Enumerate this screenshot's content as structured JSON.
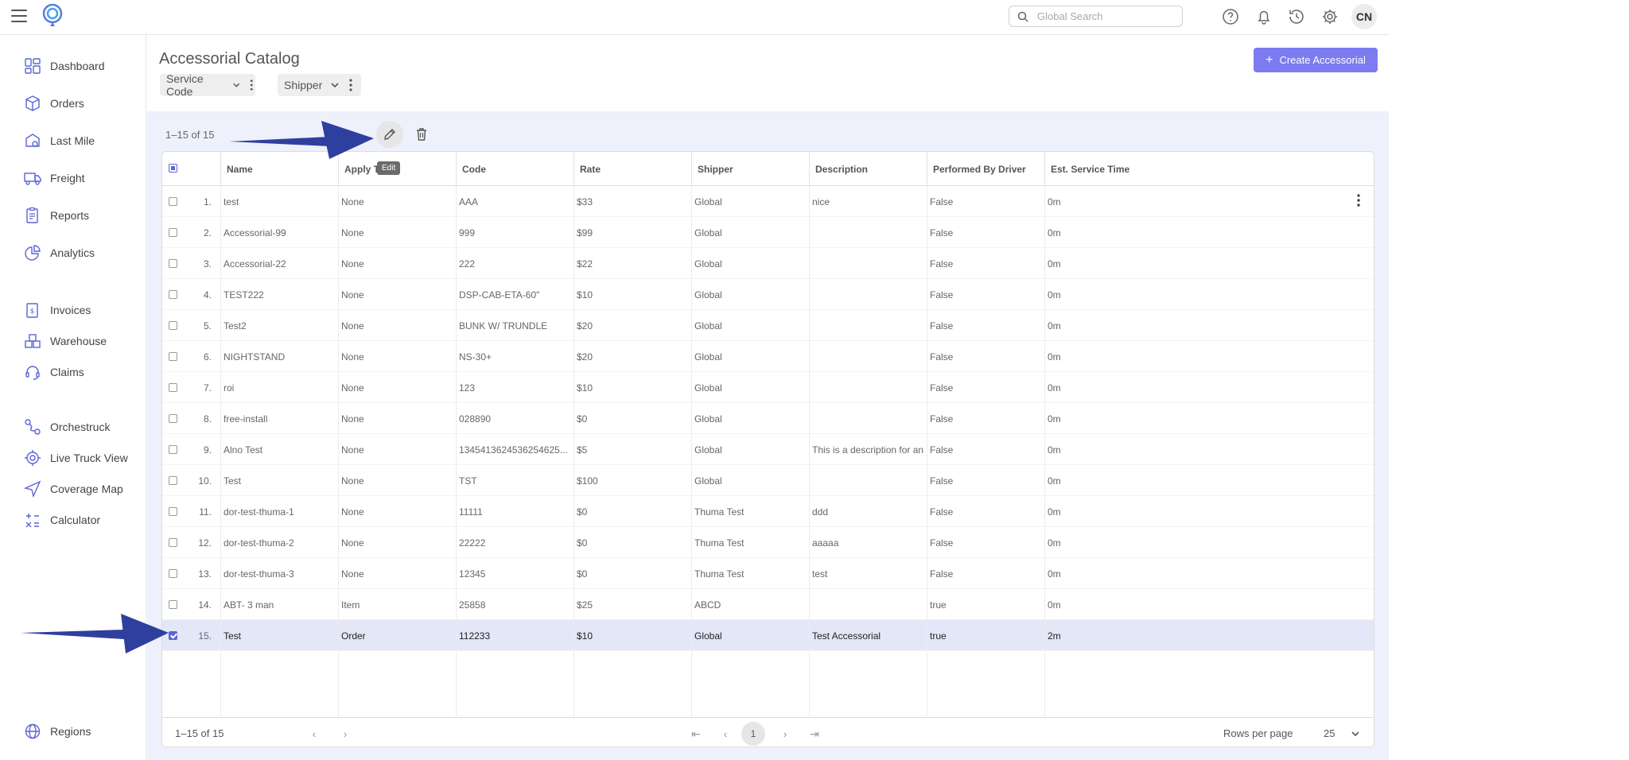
{
  "header": {
    "search_placeholder": "Global Search",
    "avatar_initials": "CN"
  },
  "sidebar": {
    "items": [
      {
        "label": "Dashboard",
        "icon": "dashboard-icon"
      },
      {
        "label": "Orders",
        "icon": "box-icon"
      },
      {
        "label": "Last Mile",
        "icon": "last-mile-icon"
      },
      {
        "label": "Freight",
        "icon": "truck-icon"
      },
      {
        "label": "Reports",
        "icon": "reports-icon"
      },
      {
        "label": "Analytics",
        "icon": "analytics-icon"
      },
      {
        "label": "Invoices",
        "icon": "invoice-icon"
      },
      {
        "label": "Warehouse",
        "icon": "warehouse-icon"
      },
      {
        "label": "Claims",
        "icon": "headset-icon"
      },
      {
        "label": "Orchestruck",
        "icon": "route-icon"
      },
      {
        "label": "Live Truck View",
        "icon": "target-icon"
      },
      {
        "label": "Coverage Map",
        "icon": "navigation-icon"
      },
      {
        "label": "Calculator",
        "icon": "calculator-icon"
      },
      {
        "label": "Regions",
        "icon": "globe-icon"
      }
    ]
  },
  "page": {
    "title": "Accessorial Catalog",
    "filters": [
      "Service Code",
      "Shipper"
    ],
    "create_button": "Create Accessorial",
    "count_top": "1–15 of 15",
    "edit_tooltip": "Edit"
  },
  "table": {
    "columns": [
      "Name",
      "Apply To",
      "Code",
      "Rate",
      "Shipper",
      "Description",
      "Performed By Driver",
      "Est. Service Time"
    ],
    "rows": [
      {
        "n": "1.",
        "name": "test",
        "apply": "None",
        "code": "AAA",
        "rate": "$33",
        "shipper": "Global",
        "desc": "nice",
        "driver": "False",
        "time": "0m"
      },
      {
        "n": "2.",
        "name": "Accessorial-99",
        "apply": "None",
        "code": "999",
        "rate": "$99",
        "shipper": "Global",
        "desc": "",
        "driver": "False",
        "time": "0m"
      },
      {
        "n": "3.",
        "name": "Accessorial-22",
        "apply": "None",
        "code": "222",
        "rate": "$22",
        "shipper": "Global",
        "desc": "",
        "driver": "False",
        "time": "0m"
      },
      {
        "n": "4.",
        "name": "TEST222",
        "apply": "None",
        "code": "DSP-CAB-ETA-60\"",
        "rate": "$10",
        "shipper": "Global",
        "desc": "",
        "driver": "False",
        "time": "0m"
      },
      {
        "n": "5.",
        "name": "Test2",
        "apply": "None",
        "code": "BUNK W/ TRUNDLE",
        "rate": "$20",
        "shipper": "Global",
        "desc": "",
        "driver": "False",
        "time": "0m"
      },
      {
        "n": "6.",
        "name": "NIGHTSTAND",
        "apply": "None",
        "code": "NS-30+",
        "rate": "$20",
        "shipper": "Global",
        "desc": "",
        "driver": "False",
        "time": "0m"
      },
      {
        "n": "7.",
        "name": "roi",
        "apply": "None",
        "code": "123",
        "rate": "$10",
        "shipper": "Global",
        "desc": "",
        "driver": "False",
        "time": "0m"
      },
      {
        "n": "8.",
        "name": "free-install",
        "apply": "None",
        "code": "028890",
        "rate": "$0",
        "shipper": "Global",
        "desc": "",
        "driver": "False",
        "time": "0m"
      },
      {
        "n": "9.",
        "name": "Alno Test",
        "apply": "None",
        "code": "1345413624536254625...",
        "rate": "$5",
        "shipper": "Global",
        "desc": "This is a description for an",
        "driver": "False",
        "time": "0m"
      },
      {
        "n": "10.",
        "name": "Test",
        "apply": "None",
        "code": "TST",
        "rate": "$100",
        "shipper": "Global",
        "desc": "",
        "driver": "False",
        "time": "0m"
      },
      {
        "n": "11.",
        "name": "dor-test-thuma-1",
        "apply": "None",
        "code": "11111",
        "rate": "$0",
        "shipper": "Thuma Test",
        "desc": "ddd",
        "driver": "False",
        "time": "0m"
      },
      {
        "n": "12.",
        "name": "dor-test-thuma-2",
        "apply": "None",
        "code": "22222",
        "rate": "$0",
        "shipper": "Thuma Test",
        "desc": "aaaaa",
        "driver": "False",
        "time": "0m"
      },
      {
        "n": "13.",
        "name": "dor-test-thuma-3",
        "apply": "None",
        "code": "12345",
        "rate": "$0",
        "shipper": "Thuma Test",
        "desc": "test",
        "driver": "False",
        "time": "0m"
      },
      {
        "n": "14.",
        "name": "ABT- 3 man",
        "apply": "Item",
        "code": "25858",
        "rate": "$25",
        "shipper": "ABCD",
        "desc": "",
        "driver": "true",
        "time": "0m"
      },
      {
        "n": "15.",
        "name": "Test",
        "apply": "Order",
        "code": "112233",
        "rate": "$10",
        "shipper": "Global",
        "desc": "Test Accessorial",
        "driver": "true",
        "time": "2m",
        "selected": true
      }
    ]
  },
  "footer": {
    "count": "1–15 of 15",
    "current_page": "1",
    "rows_per_page_label": "Rows per page",
    "rows_per_page_value": "25"
  },
  "colors": {
    "accent": "#7c7cf0",
    "annotation_arrow": "#2f3f9e",
    "selected_row": "#e4e7f8",
    "content_bg": "#eef0fb"
  }
}
